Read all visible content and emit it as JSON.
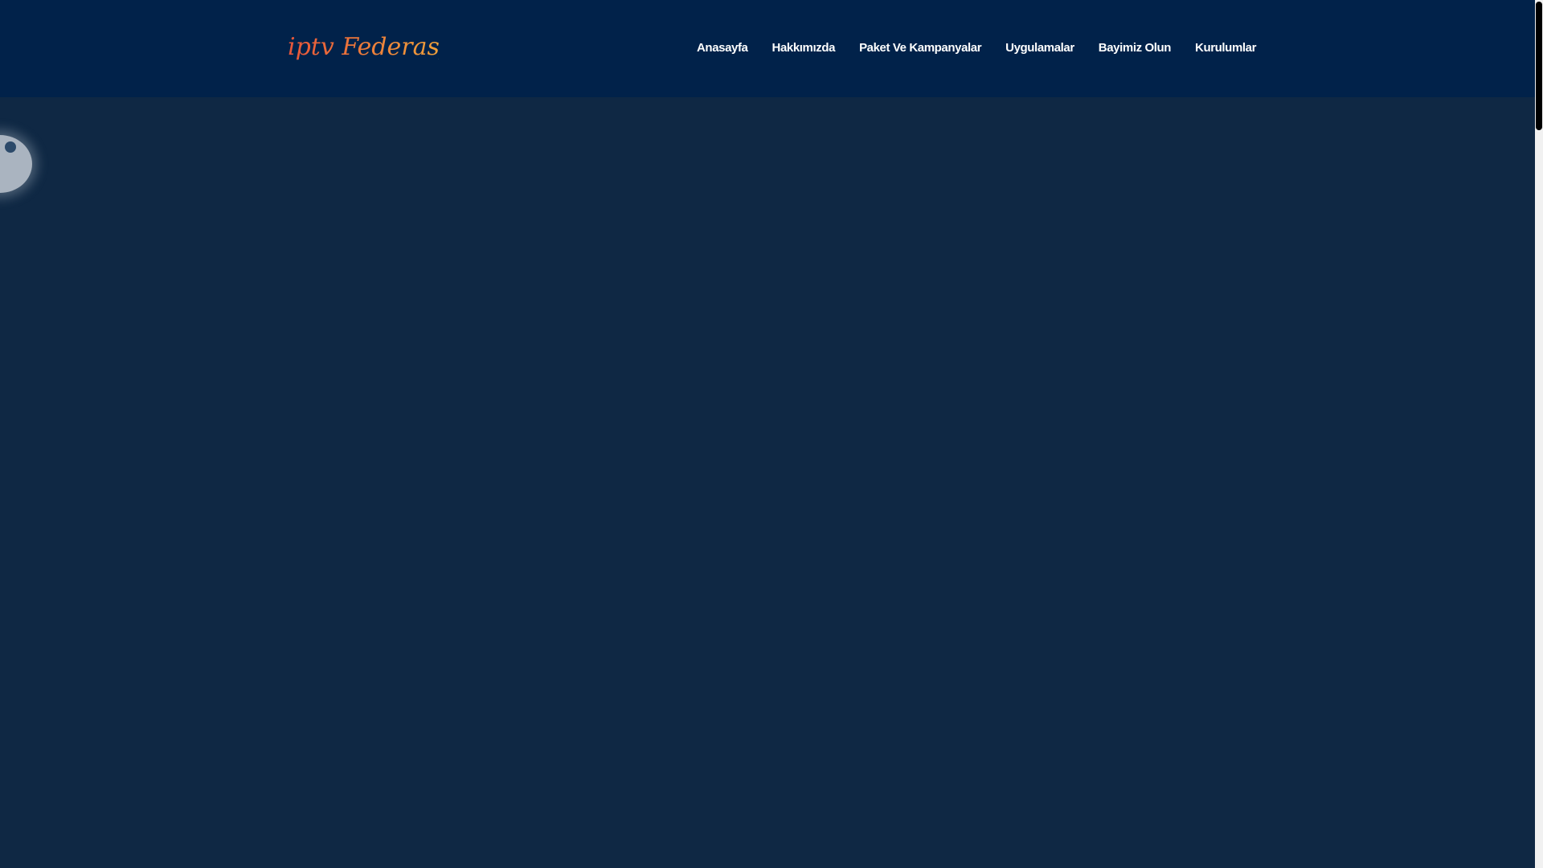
{
  "brand": {
    "logo_text": "iptv Federasyon",
    "logo_colors": [
      "#e8553a",
      "#f2b63a"
    ]
  },
  "nav": {
    "items": [
      {
        "label": "Anasayfa"
      },
      {
        "label": "Hakkımızda"
      },
      {
        "label": "Paket Ve Kampanyalar"
      },
      {
        "label": "Uygulamalar"
      },
      {
        "label": "Bayimiz Olun"
      },
      {
        "label": "Kurulumlar"
      }
    ]
  },
  "colors": {
    "header_bg": "#01224a",
    "page_bg": "#0f2844",
    "nav_text": "#ffffff"
  }
}
